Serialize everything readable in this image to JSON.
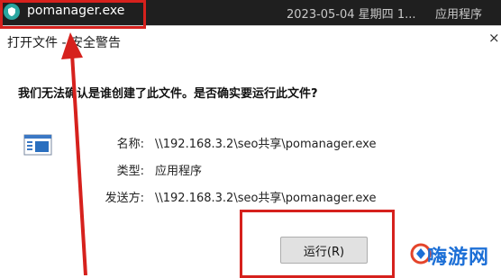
{
  "file_row": {
    "name": "pomanager.exe",
    "date": "2023-05-04 星期四 1...",
    "type": "应用程序"
  },
  "dialog": {
    "title": "打开文件 - 安全警告",
    "close_glyph": "×",
    "question": "我们无法确认是谁创建了此文件。是否确实要运行此文件?",
    "fields": [
      {
        "label": "名称:",
        "value": "\\\\192.168.3.2\\seo共享\\pomanager.exe"
      },
      {
        "label": "类型:",
        "value": "应用程序"
      },
      {
        "label": "发送方:",
        "value": "\\\\192.168.3.2\\seo共享\\pomanager.exe"
      }
    ],
    "run_button": "运行(R)"
  },
  "icons": {
    "file": "app-shield-icon",
    "dialog_app": "window-app-icon"
  },
  "annotation_color": "#d6211d",
  "watermark": "嗨游网"
}
